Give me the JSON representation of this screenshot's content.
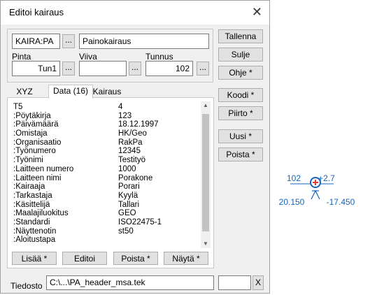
{
  "window": {
    "title": "Editoi kairaus",
    "close_glyph": "✕"
  },
  "top": {
    "code_value": "KAIRA:PA",
    "code_desc": "Painokairaus",
    "dots": "..."
  },
  "fields": {
    "pinta_label": "Pinta",
    "pinta_value": "Tun1",
    "viiva_label": "Viiva",
    "viiva_value": "",
    "tunnus_label": "Tunnus",
    "tunnus_value": "102"
  },
  "side_buttons": {
    "tallenna": "Tallenna",
    "sulje": "Sulje",
    "ohje": "Ohje *",
    "koodi": "Koodi *",
    "piirto": "Piirto *",
    "uusi": "Uusi *",
    "poista": "Poista *"
  },
  "tabs": {
    "xyz": "XYZ",
    "data": "Data (16)",
    "kairaus": "Kairaus"
  },
  "data_rows": [
    {
      "key": "T5",
      "value": "4"
    },
    {
      "key": ":Pöytäkirja",
      "value": "123"
    },
    {
      "key": ":Päivämäärä",
      "value": "18.12.1997"
    },
    {
      "key": ":Omistaja",
      "value": "HK/Geo"
    },
    {
      "key": ":Organisaatio",
      "value": "RakPa"
    },
    {
      "key": ":Työnumero",
      "value": "12345"
    },
    {
      "key": ":Työnimi",
      "value": "Testityö"
    },
    {
      "key": ":Laitteen numero",
      "value": "1000"
    },
    {
      "key": ":Laitteen nimi",
      "value": "Porakone"
    },
    {
      "key": ":Kairaaja",
      "value": "Porari"
    },
    {
      "key": ":Tarkastaja",
      "value": "Kyylä"
    },
    {
      "key": ":Käsittelijä",
      "value": "Tallari"
    },
    {
      "key": ":Maalajiluokitus",
      "value": "GEO"
    },
    {
      "key": ":Standardi",
      "value": "ISO22475-1"
    },
    {
      "key": ":Näyttenotin",
      "value": "st50"
    },
    {
      "key": ":Aloitustapa",
      "value": ""
    }
  ],
  "list_buttons": {
    "lisaa": "Lisää *",
    "editoi": "Editoi",
    "poista": "Poista *",
    "nayta": "Näytä *"
  },
  "footer": {
    "tiedosto_label": "Tiedosto",
    "path": "C:\\...\\PA_header_msa.tek",
    "x_button": "X"
  },
  "symbol": {
    "id": "102",
    "elev": "+2.7",
    "left": "20.150",
    "right": "-17.450",
    "color": "#1565c0"
  }
}
